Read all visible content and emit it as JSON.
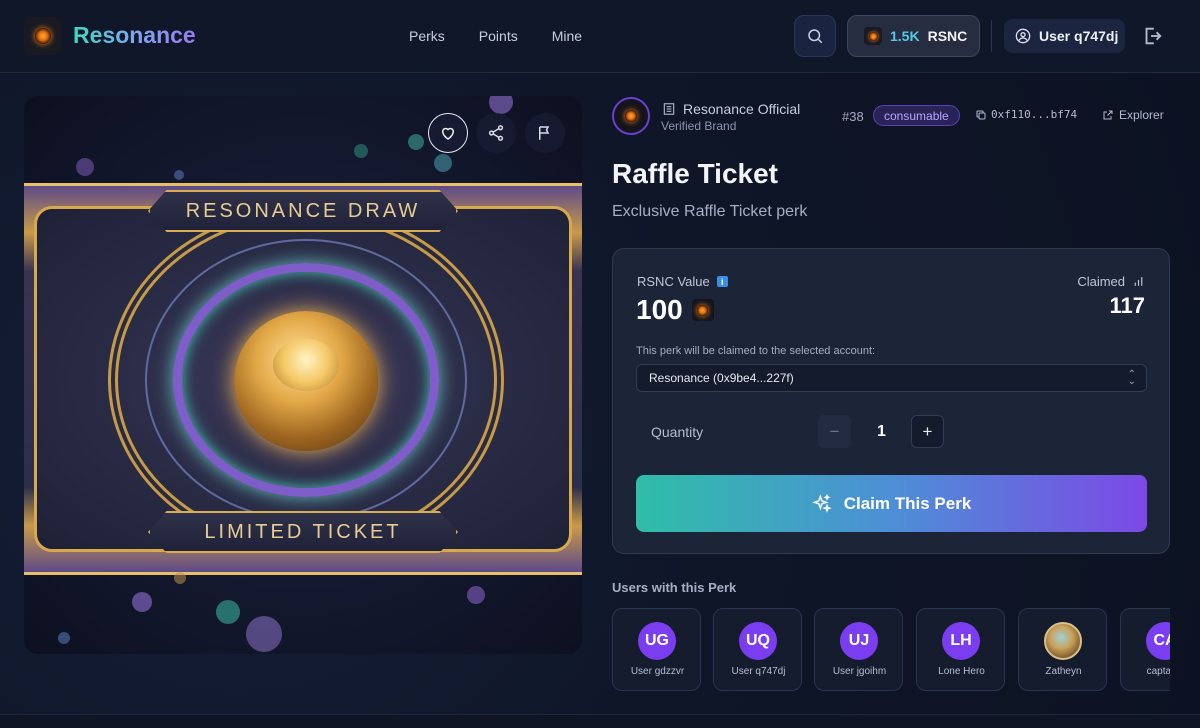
{
  "header": {
    "brand": "Resonance",
    "nav": [
      "Perks",
      "Points",
      "Mine"
    ],
    "balance_amount": "1.5K",
    "balance_token": "RSNC",
    "user_label": "User q747dj"
  },
  "hero": {
    "top_banner": "RESONANCE DRAW",
    "bottom_banner": "LIMITED TICKET"
  },
  "perk": {
    "brand_name": "Resonance Official",
    "brand_status": "Verified Brand",
    "token_id": "#38",
    "type_badge": "consumable",
    "contract": "0xf110...bf74",
    "explorer_label": "Explorer",
    "title": "Raffle Ticket",
    "subtitle": "Exclusive Raffle Ticket perk"
  },
  "claim_card": {
    "value_label": "RSNC Value",
    "value": "100",
    "claimed_label": "Claimed",
    "claimed_count": "117",
    "account_hint": "This perk will be claimed to the selected account:",
    "account_selected": "Resonance (0x9be4...227f)",
    "quantity_label": "Quantity",
    "quantity": "1",
    "minus": "−",
    "plus": "+",
    "claim_button": "Claim This Perk"
  },
  "holders": {
    "title": "Users with this Perk",
    "users": [
      {
        "initials": "UG",
        "name": "User gdzzvr"
      },
      {
        "initials": "UQ",
        "name": "User q747dj"
      },
      {
        "initials": "UJ",
        "name": "User jgoihm"
      },
      {
        "initials": "LH",
        "name": "Lone Hero"
      },
      {
        "initials": "",
        "name": "Zatheyn"
      },
      {
        "initials": "CA",
        "name": "captaina"
      }
    ]
  },
  "colors": {
    "accent_teal": "#2fbea8",
    "accent_purple": "#7c49e6",
    "avatar_purple": "#7a3df0",
    "balance_blue": "#56c8e8"
  }
}
